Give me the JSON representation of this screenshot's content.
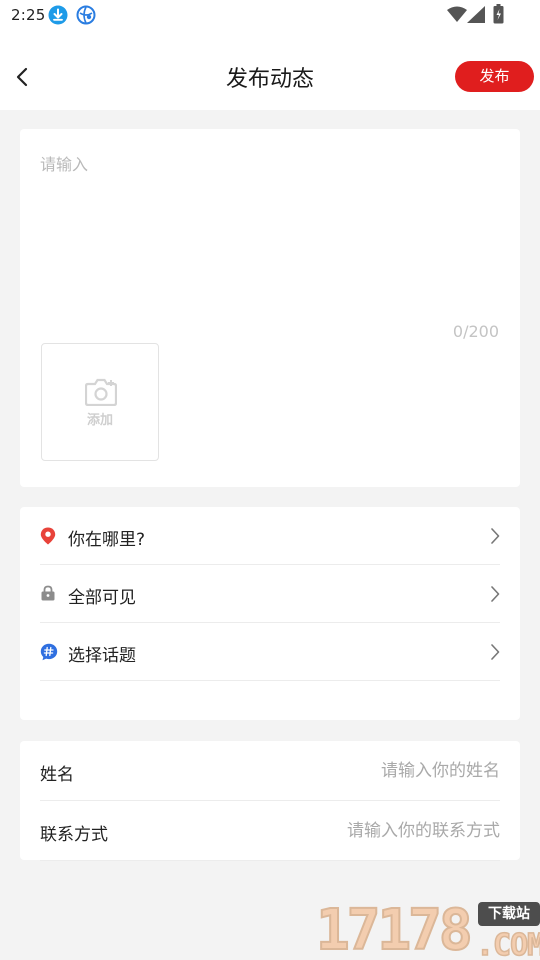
{
  "status_bar": {
    "time": "2:25",
    "icons": [
      "download-icon",
      "browser-icon",
      "wifi-icon",
      "signal-icon",
      "battery-icon"
    ]
  },
  "header": {
    "title": "发布动态",
    "publish_label": "发布",
    "back_icon": "chevron-left-icon"
  },
  "post": {
    "placeholder": "请输入",
    "char_count": "0/200",
    "add_photo_label": "添加"
  },
  "options": [
    {
      "icon": "location-pin-icon",
      "label": "你在哪里?"
    },
    {
      "icon": "lock-icon",
      "label": "全部可见"
    },
    {
      "icon": "topic-hashtag-icon",
      "label": "选择话题"
    }
  ],
  "contact": {
    "name_label": "姓名",
    "name_placeholder": "请输入你的姓名",
    "phone_label": "联系方式",
    "phone_placeholder": "请输入你的联系方式"
  },
  "watermark": {
    "number": "17178",
    "badge": "下载站",
    "domain": ".COM"
  },
  "colors": {
    "accent": "#e01e1e",
    "page_bg": "#f3f3f3",
    "location_icon": "#e8433a",
    "lock_icon": "#8c8c8c",
    "topic_icon": "#2f6fe0"
  }
}
